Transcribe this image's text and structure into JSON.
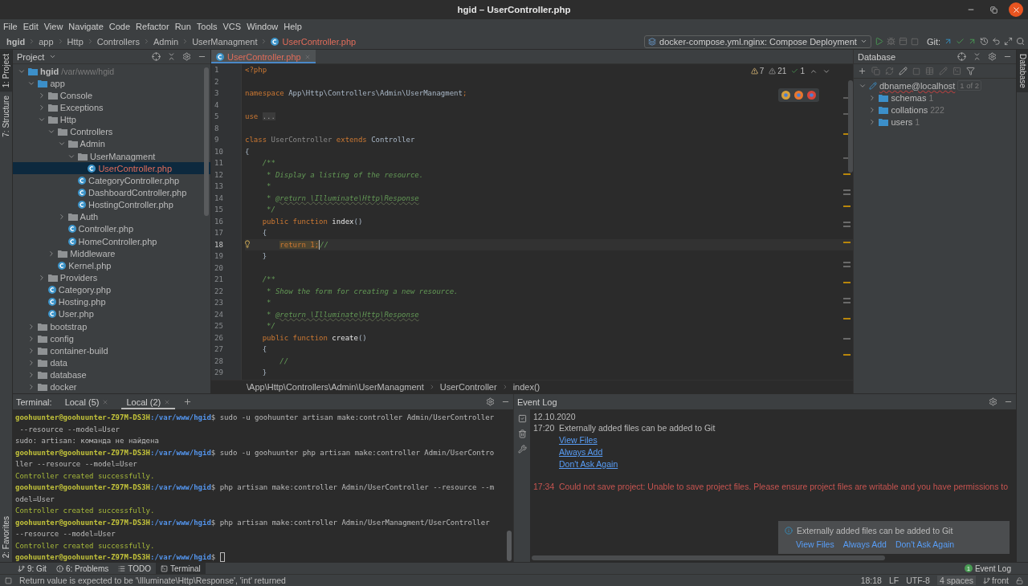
{
  "window": {
    "title": "hgid – UserController.php"
  },
  "menu": [
    "File",
    "Edit",
    "View",
    "Navigate",
    "Code",
    "Refactor",
    "Run",
    "Tools",
    "VCS",
    "Window",
    "Help"
  ],
  "nav": {
    "crumbs": [
      {
        "label": "hgid",
        "kind": "project"
      },
      {
        "label": "app",
        "kind": "folder"
      },
      {
        "label": "Http",
        "kind": "folder"
      },
      {
        "label": "Controllers",
        "kind": "folder"
      },
      {
        "label": "Admin",
        "kind": "folder"
      },
      {
        "label": "UserManagment",
        "kind": "folder"
      },
      {
        "label": "UserController.php",
        "kind": "file"
      }
    ],
    "run_config": "docker-compose.yml.nginx: Compose Deployment",
    "git_label": "Git:"
  },
  "left_strip": {
    "top": [
      {
        "label": "1: Project",
        "selected": true
      },
      {
        "label": "7: Structure",
        "selected": false
      }
    ],
    "bottom": [
      {
        "label": "2: Favorites",
        "selected": false
      }
    ]
  },
  "project": {
    "title": "Project",
    "tree": [
      {
        "name": "hgid",
        "path": "/var/www/hgid",
        "kind": "root",
        "expanded": true,
        "selected": false,
        "children": [
          {
            "name": "app",
            "kind": "source",
            "expanded": true,
            "selected": false,
            "children": [
              {
                "name": "Console",
                "kind": "folder",
                "expanded": false,
                "selected": false
              },
              {
                "name": "Exceptions",
                "kind": "folder",
                "expanded": false,
                "selected": false
              },
              {
                "name": "Http",
                "kind": "folder",
                "expanded": true,
                "selected": false,
                "children": [
                  {
                    "name": "Controllers",
                    "kind": "folder",
                    "expanded": true,
                    "selected": false,
                    "children": [
                      {
                        "name": "Admin",
                        "kind": "folder",
                        "expanded": true,
                        "selected": false,
                        "children": [
                          {
                            "name": "UserManagment",
                            "kind": "folder",
                            "expanded": true,
                            "selected": false,
                            "children": [
                              {
                                "name": "UserController.php",
                                "kind": "php",
                                "selected": true,
                                "problem": true
                              }
                            ]
                          },
                          {
                            "name": "CategoryController.php",
                            "kind": "php",
                            "selected": false,
                            "problem": false
                          },
                          {
                            "name": "DashboardController.php",
                            "kind": "php",
                            "selected": false,
                            "problem": false
                          },
                          {
                            "name": "HostingController.php",
                            "kind": "php",
                            "selected": false,
                            "problem": false
                          }
                        ]
                      },
                      {
                        "name": "Auth",
                        "kind": "folder",
                        "expanded": false,
                        "selected": false
                      },
                      {
                        "name": "Controller.php",
                        "kind": "php",
                        "selected": false,
                        "problem": false
                      },
                      {
                        "name": "HomeController.php",
                        "kind": "php",
                        "selected": false,
                        "problem": false
                      }
                    ]
                  },
                  {
                    "name": "Middleware",
                    "kind": "folder",
                    "expanded": false,
                    "selected": false
                  },
                  {
                    "name": "Kernel.php",
                    "kind": "php",
                    "selected": false,
                    "problem": false
                  }
                ]
              },
              {
                "name": "Providers",
                "kind": "folder",
                "expanded": false,
                "selected": false
              },
              {
                "name": "Category.php",
                "kind": "php",
                "selected": false,
                "problem": false
              },
              {
                "name": "Hosting.php",
                "kind": "php",
                "selected": false,
                "problem": false
              },
              {
                "name": "User.php",
                "kind": "php",
                "selected": false,
                "problem": false
              }
            ]
          },
          {
            "name": "bootstrap",
            "kind": "folder",
            "expanded": false,
            "selected": false
          },
          {
            "name": "config",
            "kind": "folder",
            "expanded": false,
            "selected": false
          },
          {
            "name": "container-build",
            "kind": "folder",
            "expanded": false,
            "selected": false
          },
          {
            "name": "data",
            "kind": "folder",
            "expanded": false,
            "selected": false
          },
          {
            "name": "database",
            "kind": "folder",
            "expanded": false,
            "selected": false
          },
          {
            "name": "docker",
            "kind": "folder",
            "expanded": false,
            "selected": false
          }
        ]
      }
    ]
  },
  "editor": {
    "tabs": [
      {
        "label": "UserController.php",
        "selected": true,
        "problem": true
      }
    ],
    "inspections": {
      "warnings": "7",
      "weak_warnings": "21",
      "typos": "1"
    },
    "lines": [
      {
        "no": "1",
        "current": false,
        "tokens": [
          {
            "text": "<?php",
            "kind": "tag"
          }
        ]
      },
      {
        "no": "2",
        "current": false
      },
      {
        "no": "3",
        "current": false,
        "tokens": [
          {
            "text": "namespace",
            "kind": "keyword"
          },
          {
            "text": " App\\Http\\Controllers\\Admin\\UserManagment",
            "kind": "plain"
          },
          {
            "text": ";",
            "kind": "keyword"
          }
        ]
      },
      {
        "no": "4",
        "current": false
      },
      {
        "no": "5",
        "current": false,
        "tokens": [
          {
            "text": "use",
            "kind": "keyword"
          },
          {
            "text": "...",
            "kind": "fold"
          }
        ]
      },
      {
        "no": "8",
        "current": false
      },
      {
        "no": "9",
        "current": false,
        "tokens": [
          {
            "text": "class",
            "kind": "keyword"
          },
          {
            "text": " UserController",
            "kind": "unused"
          },
          {
            "text": " extends",
            "kind": "keyword"
          },
          {
            "text": " Controller",
            "kind": "plain"
          }
        ]
      },
      {
        "no": "10",
        "current": false,
        "tokens": [
          {
            "text": "{",
            "kind": "plain"
          }
        ]
      },
      {
        "no": "11",
        "current": false,
        "tokens": [
          {
            "text": "    /**",
            "kind": "comment"
          }
        ]
      },
      {
        "no": "12",
        "current": false,
        "tokens": [
          {
            "text": "     * Display a listing of the resource.",
            "kind": "comment"
          }
        ]
      },
      {
        "no": "13",
        "current": false,
        "tokens": [
          {
            "text": "     *",
            "kind": "comment"
          }
        ]
      },
      {
        "no": "14",
        "current": false,
        "tokens": [
          {
            "text": "     * ",
            "kind": "comment"
          },
          {
            "text": "@return \\Illuminate\\Http\\Response",
            "kind": "doctag"
          }
        ]
      },
      {
        "no": "15",
        "current": false,
        "tokens": [
          {
            "text": "     */",
            "kind": "comment"
          }
        ]
      },
      {
        "no": "16",
        "current": false,
        "tokens": [
          {
            "text": "    public function",
            "kind": "keyword"
          },
          {
            "text": " index",
            "kind": "function"
          },
          {
            "text": "()",
            "kind": "plain"
          }
        ]
      },
      {
        "no": "17",
        "current": false,
        "tokens": [
          {
            "text": "    {",
            "kind": "plain"
          }
        ]
      },
      {
        "no": "18",
        "current": true,
        "tokens": [
          {
            "text": "return 1;",
            "kind": "highlight"
          },
          {
            "text": "//",
            "kind": "comment"
          }
        ]
      },
      {
        "no": "19",
        "current": false,
        "tokens": [
          {
            "text": "    }",
            "kind": "plain"
          }
        ]
      },
      {
        "no": "20",
        "current": false
      },
      {
        "no": "21",
        "current": false,
        "tokens": [
          {
            "text": "    /**",
            "kind": "comment"
          }
        ]
      },
      {
        "no": "22",
        "current": false,
        "tokens": [
          {
            "text": "     * Show the form for creating a new resource.",
            "kind": "comment"
          }
        ]
      },
      {
        "no": "23",
        "current": false,
        "tokens": [
          {
            "text": "     *",
            "kind": "comment"
          }
        ]
      },
      {
        "no": "24",
        "current": false,
        "tokens": [
          {
            "text": "     * ",
            "kind": "comment"
          },
          {
            "text": "@return \\Illuminate\\Http\\Response",
            "kind": "doctag"
          }
        ]
      },
      {
        "no": "25",
        "current": false,
        "tokens": [
          {
            "text": "     */",
            "kind": "comment"
          }
        ]
      },
      {
        "no": "26",
        "current": false,
        "tokens": [
          {
            "text": "    public function",
            "kind": "keyword"
          },
          {
            "text": " create",
            "kind": "function"
          },
          {
            "text": "()",
            "kind": "plain"
          }
        ]
      },
      {
        "no": "27",
        "current": false,
        "tokens": [
          {
            "text": "    {",
            "kind": "plain"
          }
        ]
      },
      {
        "no": "28",
        "current": false,
        "tokens": [
          {
            "text": "        //",
            "kind": "comment"
          }
        ]
      },
      {
        "no": "29",
        "current": false,
        "tokens": [
          {
            "text": "    }",
            "kind": "plain"
          }
        ]
      }
    ],
    "breadcrumbs": [
      "\\App\\Http\\Controllers\\Admin\\UserManagment",
      "UserController",
      "index()"
    ]
  },
  "database": {
    "title": "Database",
    "tree": [
      {
        "name": "dbname@localhost",
        "badge": "1 of 2",
        "expanded": true,
        "children": [
          {
            "name": "schemas",
            "count": "1",
            "expanded": false
          },
          {
            "name": "collations",
            "count": "222",
            "expanded": false
          },
          {
            "name": "users",
            "count": "1",
            "expanded": false
          }
        ]
      }
    ]
  },
  "right_strip": [
    {
      "label": "Database",
      "selected": true
    }
  ],
  "terminal": {
    "label": "Terminal:",
    "tabs": [
      {
        "label": "Local (5)",
        "selected": false
      },
      {
        "label": "Local (2)",
        "selected": true
      }
    ],
    "lines": [
      {
        "kind": "prompt",
        "user": "goohuunter@goohuunter-Z97M-DS3H",
        "path": ":/var/www/hgid",
        "command": "$ sudo -u goohuunter artisan make:controller Admin/UserController",
        "cursor": false
      },
      {
        "kind": "text",
        "text": " --resource --model=User"
      },
      {
        "kind": "text",
        "text": "sudo: artisan: команда не найдена"
      },
      {
        "kind": "prompt",
        "user": "goohuunter@goohuunter-Z97M-DS3H",
        "path": ":/var/www/hgid",
        "command": "$ sudo -u goohuunter php artisan make:controller Admin/UserContro",
        "cursor": false
      },
      {
        "kind": "text",
        "text": "ller --resource --model=User"
      },
      {
        "kind": "success",
        "text": "Controller created successfully."
      },
      {
        "kind": "prompt",
        "user": "goohuunter@goohuunter-Z97M-DS3H",
        "path": ":/var/www/hgid",
        "command": "$ php artisan make:controller Admin/UserController --resource --m",
        "cursor": false
      },
      {
        "kind": "text",
        "text": "odel=User"
      },
      {
        "kind": "success",
        "text": "Controller created successfully."
      },
      {
        "kind": "prompt",
        "user": "goohuunter@goohuunter-Z97M-DS3H",
        "path": ":/var/www/hgid",
        "command": "$ php artisan make:controller Admin/UserManagment/UserController",
        "cursor": false
      },
      {
        "kind": "text",
        "text": "--resource --model=User"
      },
      {
        "kind": "success",
        "text": "Controller created successfully."
      },
      {
        "kind": "prompt",
        "user": "goohuunter@goohuunter-Z97M-DS3H",
        "path": ":/var/www/hgid",
        "command": "$ ",
        "cursor": true
      }
    ]
  },
  "event_log": {
    "title": "Event Log",
    "date": "12.10.2020",
    "entries": [
      {
        "time": "17:20",
        "kind": "info",
        "message": "Externally added files can be added to Git",
        "links": [
          "View Files",
          "Always Add",
          "Don't Ask Again"
        ]
      },
      {
        "time": "17:34",
        "kind": "error",
        "message": "Could not save project: Unable to save project files. Please ensure project files are writable and you have permissions to"
      }
    ],
    "balloon": {
      "message": "Externally added files can be added to Git",
      "links": [
        "View Files",
        "Always Add",
        "Don't Ask Again"
      ]
    }
  },
  "tool_buttons": [
    {
      "label": "9: Git",
      "kind": "git",
      "selected": false
    },
    {
      "label": "6: Problems",
      "kind": "problems",
      "selected": false
    },
    {
      "label": "TODO",
      "kind": "todo",
      "selected": false
    },
    {
      "label": "Terminal",
      "kind": "terminal",
      "selected": true
    }
  ],
  "event_log_button": {
    "label": "Event Log",
    "badge": "1"
  },
  "status_bar": {
    "message": "Return value is expected to be '\\Illuminate\\Http\\Response', 'int' returned",
    "position": "18:18",
    "line_separator": "LF",
    "encoding": "UTF-8",
    "indent": "4 spaces",
    "branch": "front"
  }
}
